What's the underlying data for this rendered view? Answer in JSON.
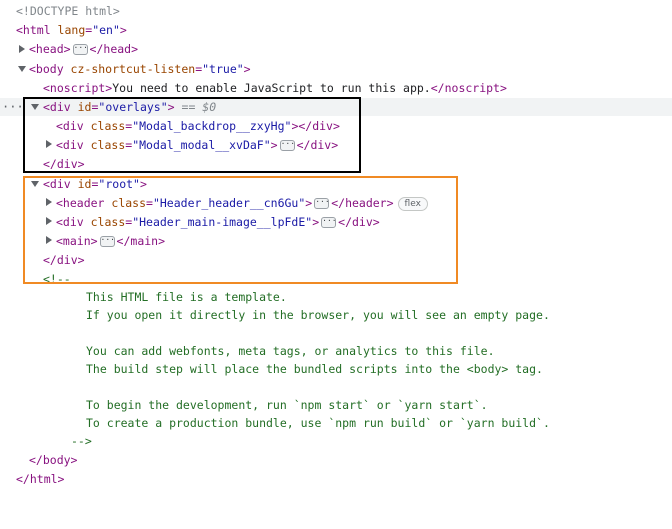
{
  "lines": {
    "l0": {
      "doctype": "<!DOCTYPE html>"
    },
    "l1": {
      "open": "<html",
      "attr": " lang",
      "eq": "=",
      "val": "\"en\"",
      "close": ">"
    },
    "l2": {
      "open": "<head>",
      "close": "</head>",
      "ellipsis": "···"
    },
    "l3": {
      "open": "<body",
      "attr": " cz-shortcut-listen",
      "eq": "=",
      "val": "\"true\"",
      "close": ">"
    },
    "l4": {
      "open": "<noscript>",
      "text": "You need to enable JavaScript to run this app.",
      "close": "</noscript>"
    },
    "l5": {
      "open": "<div",
      "attr": " id",
      "eq": "=",
      "val": "\"overlays\"",
      "close": ">",
      "ref": " == $0"
    },
    "l6": {
      "open": "<div",
      "attr": " class",
      "eq": "=",
      "val": "\"Modal_backdrop__zxyHg\"",
      "close": "></div>"
    },
    "l7": {
      "open": "<div",
      "attr": " class",
      "eq": "=",
      "val": "\"Modal_modal__xvDaF\"",
      "close": ">",
      "ellipsis": "···",
      "end": "</div>"
    },
    "l8": {
      "close": "</div>"
    },
    "l9": {
      "open": "<div",
      "attr": " id",
      "eq": "=",
      "val": "\"root\"",
      "close": ">"
    },
    "l10": {
      "open": "<header",
      "attr": " class",
      "eq": "=",
      "val": "\"Header_header__cn6Gu\"",
      "close": ">",
      "ellipsis": "···",
      "end": "</header>",
      "badge": "flex"
    },
    "l11": {
      "open": "<div",
      "attr": " class",
      "eq": "=",
      "val": "\"Header_main-image__lpFdE\"",
      "close": ">",
      "ellipsis": "···",
      "end": "</div>"
    },
    "l12": {
      "open": "<main>",
      "ellipsis": "···",
      "end": "</main>"
    },
    "l13": {
      "close": "</div>"
    },
    "l14": {
      "text": "<!--"
    },
    "l15": {
      "text": "This HTML file is a template."
    },
    "l16": {
      "text": "If you open it directly in the browser, you will see an empty page."
    },
    "l17": {
      "text": "You can add webfonts, meta tags, or analytics to this file."
    },
    "l18": {
      "text": "The build step will place the bundled scripts into the <body> tag."
    },
    "l19": {
      "text": "To begin the development, run `npm start` or `yarn start`."
    },
    "l20": {
      "text": "To create a production bundle, use `npm run build` or `yarn build`."
    },
    "l21": {
      "text": "-->"
    },
    "l22": {
      "close": "</body>"
    },
    "l23": {
      "close": "</html>"
    }
  },
  "gutter_dots": "···",
  "colors": {
    "selection_box": "#000000",
    "highlight_box": "#f08a24",
    "tag": "#881280",
    "attr": "#994500",
    "value": "#1a1aa6",
    "comment": "#236e25"
  }
}
